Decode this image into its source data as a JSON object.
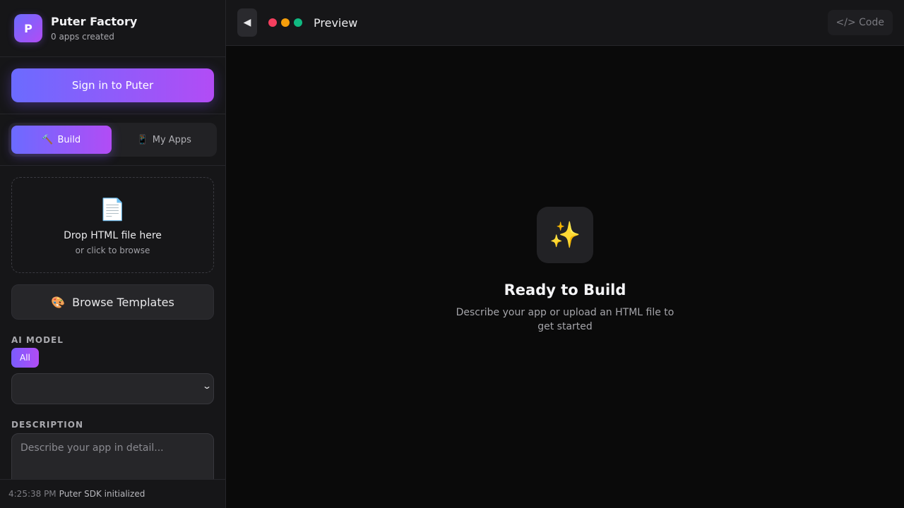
{
  "brand": {
    "logo_letter": "P",
    "title": "Puter Factory",
    "subtitle": "0 apps created"
  },
  "auth": {
    "signin_label": "Sign in to Puter"
  },
  "tabs": [
    {
      "icon": "🔨",
      "label": "Build",
      "active": true
    },
    {
      "icon": "📱",
      "label": "My Apps",
      "active": false
    }
  ],
  "dropzone": {
    "icon": "📄",
    "title": "Drop HTML file here",
    "subtitle": "or click to browse"
  },
  "templates": {
    "icon": "🎨",
    "label": "Browse Templates"
  },
  "model": {
    "label": "AI MODEL",
    "chip": "All",
    "selected": ""
  },
  "description": {
    "label": "DESCRIPTION",
    "placeholder": "Describe your app in detail..."
  },
  "status": {
    "time": "4:25:38 PM",
    "message": "Puter SDK initialized"
  },
  "topbar": {
    "back_icon": "◀",
    "title": "Preview",
    "code_label": "</> Code",
    "dots": [
      "#f43f5e",
      "#f59e0b",
      "#10b981"
    ]
  },
  "empty_state": {
    "icon": "✨",
    "title": "Ready to Build",
    "subtitle": "Describe your app or upload an HTML file to get started"
  },
  "colors": {
    "accent_start": "#6b6bff",
    "accent_end": "#b24cf5",
    "background": "#0a0a0a",
    "panel": "#161618"
  }
}
